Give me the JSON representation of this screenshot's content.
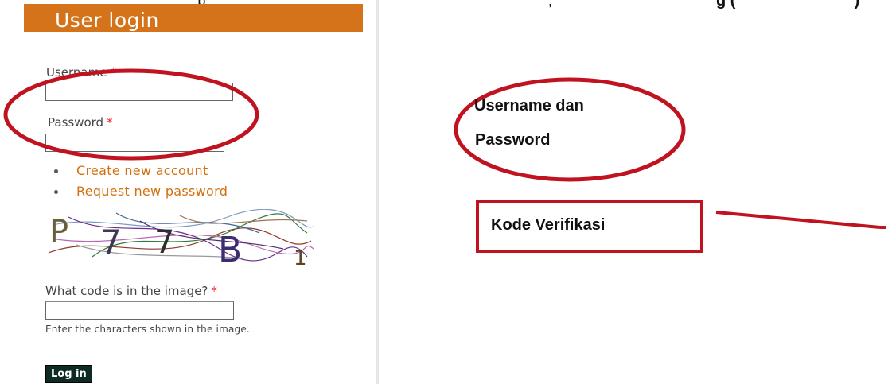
{
  "top_text": {
    "left_fragment": ", p",
    "middle_fragment": ",",
    "right_fragment": "g   (",
    "right_end": ")"
  },
  "login_block": {
    "title": "User login",
    "username_label": "Username",
    "password_label": "Password",
    "required_mark": "*",
    "username_value": "",
    "password_value": "",
    "links": [
      {
        "label": "Create new account"
      },
      {
        "label": "Request new password"
      }
    ],
    "captcha": {
      "alt_chars": "P7 7B 1"
    },
    "captcha_question": "What code is in the image?",
    "captcha_value": "",
    "captcha_help": "Enter the characters shown in the image.",
    "login_button": "Log in"
  },
  "annotations": {
    "username_password_line1": "Username dan",
    "username_password_line2": "Password",
    "kode_verifikasi": "Kode Verifikasi"
  },
  "colors": {
    "header_bg": "#d4731a",
    "link_color": "#d2700f",
    "required": "#ee2222",
    "annotation_red": "#c0121f",
    "button_bg": "#0e2a24"
  }
}
